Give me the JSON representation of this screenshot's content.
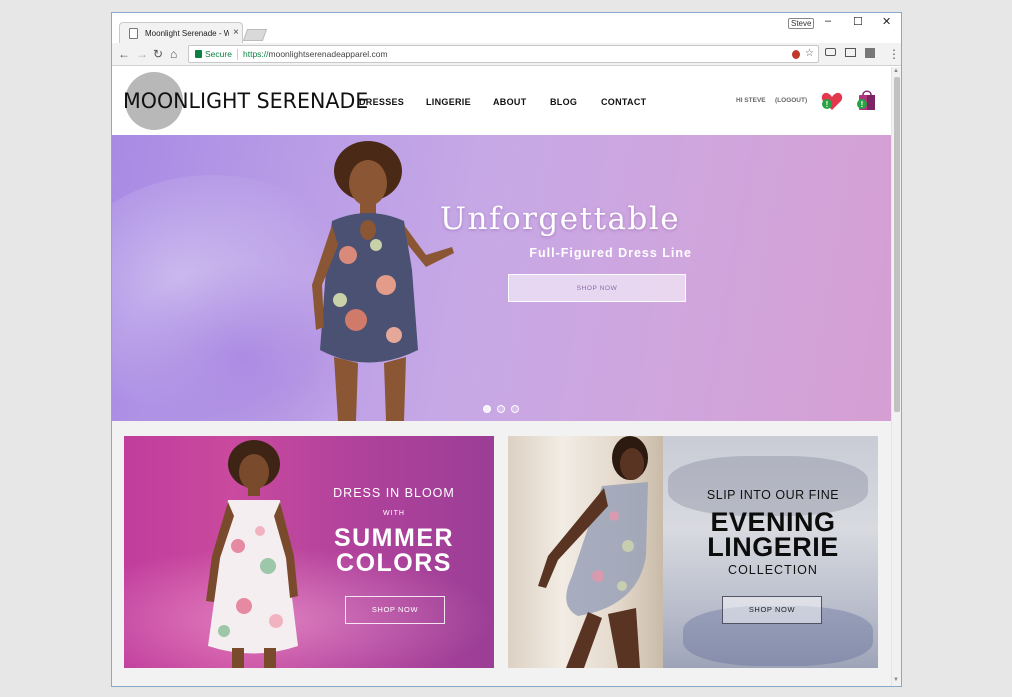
{
  "browser": {
    "tab_title": "Moonlight Serenade - W",
    "tab_close": "×",
    "profile_name": "Steve",
    "minimize": "–",
    "maximize": "☐",
    "close": "✕",
    "secure_label": "Secure",
    "url_scheme": "https://",
    "url_host": "moonlightserenadeapparel.com",
    "back": "←",
    "forward": "→",
    "reload": "↻",
    "home": "⌂",
    "star": "☆",
    "menu": "⋮"
  },
  "site": {
    "logo": "MOONLIGHT SERENADE",
    "nav": [
      "DRESSES",
      "LINGERIE",
      "ABOUT",
      "BLOG",
      "CONTACT"
    ],
    "greeting": "HI STEVE",
    "logout": "(LOGOUT)",
    "wishlist_badge": "!",
    "cart_badge": "!"
  },
  "hero": {
    "title": "Unforgettable",
    "subtitle": "Full-Figured Dress Line",
    "button": "SHOP NOW",
    "slides": 3,
    "active_slide": 1
  },
  "promos": [
    {
      "line1": "DRESS IN BLOOM",
      "line2": "WITH",
      "line3a": "SUMMER",
      "line3b": "COLORS",
      "button": "SHOP NOW"
    },
    {
      "line1": "SLIP INTO OUR FINE",
      "line2a": "EVENING",
      "line2b": "LINGERIE",
      "line3": "COLLECTION",
      "button": "SHOP NOW"
    }
  ],
  "colors": {
    "accent_green": "#0b8043",
    "hero_purple": "#c6a8e6",
    "promo_magenta": "#c13d9c"
  }
}
